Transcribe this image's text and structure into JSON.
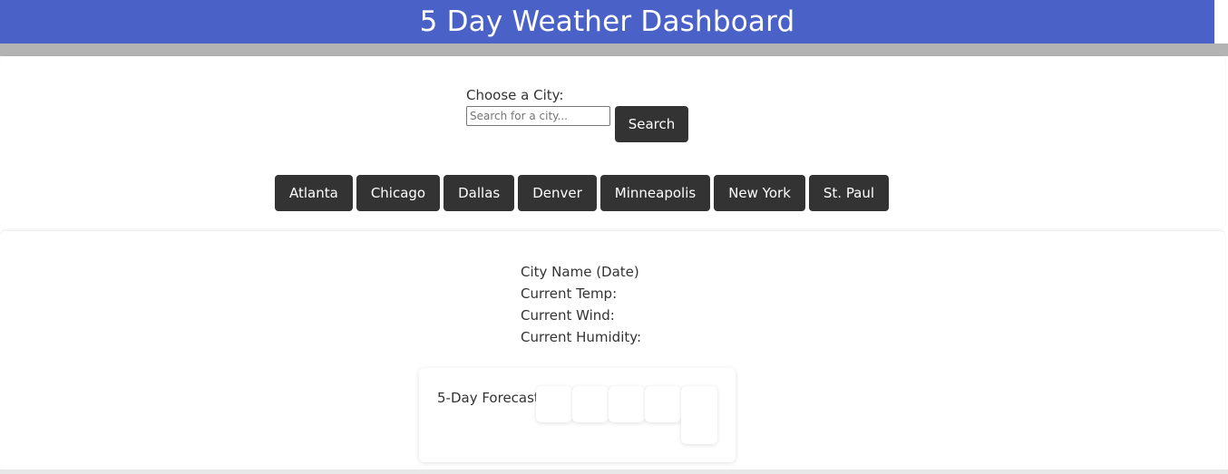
{
  "header": {
    "title": "5 Day Weather Dashboard"
  },
  "search": {
    "label": "Choose a City:",
    "placeholder": "Search for a city...",
    "value": "",
    "button_label": "Search"
  },
  "cities": [
    "Atlanta",
    "Chicago",
    "Dallas",
    "Denver",
    "Minneapolis",
    "New York",
    "St. Paul"
  ],
  "current": {
    "city_date": "City Name (Date)",
    "temp": "Current Temp:",
    "wind": "Current Wind:",
    "humidity": "Current Humidity:"
  },
  "forecast": {
    "label": "5-Day Forecast:"
  },
  "colors": {
    "header": "#4a61c8",
    "button": "#333333"
  }
}
